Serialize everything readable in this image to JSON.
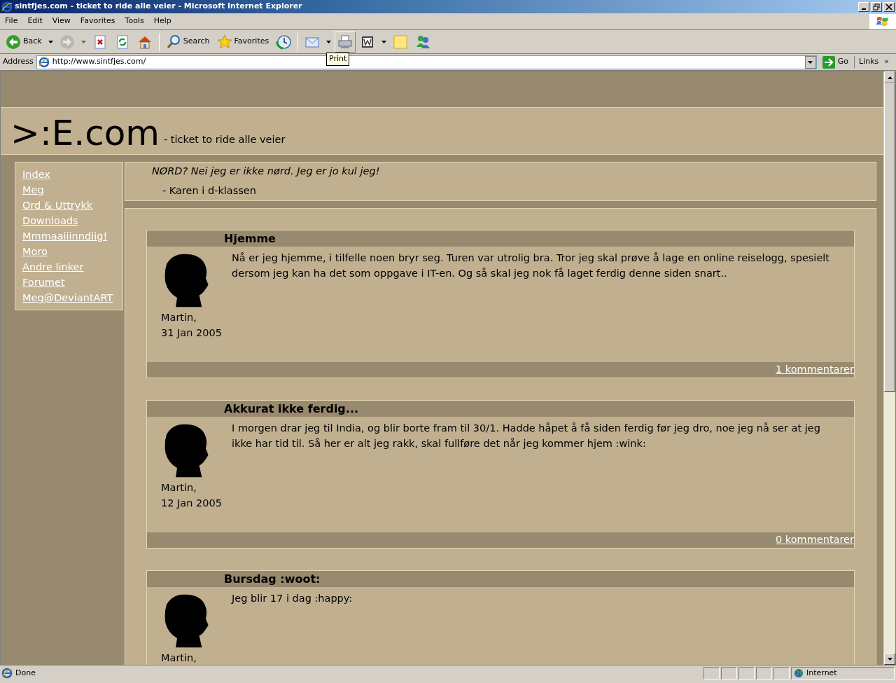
{
  "window": {
    "title": "sintfjes.com - ticket to ride alle veier - Microsoft Internet Explorer"
  },
  "menu": [
    "File",
    "Edit",
    "View",
    "Favorites",
    "Tools",
    "Help"
  ],
  "toolbar": [
    {
      "kind": "button",
      "label": "Back",
      "dropdown": true,
      "disabled": false,
      "hover": false
    },
    {
      "kind": "button",
      "dropdown": true,
      "disabled": true,
      "hover": false
    },
    {
      "kind": "button",
      "disabled": false,
      "hover": false
    },
    {
      "kind": "button",
      "disabled": false,
      "hover": false
    },
    {
      "kind": "button",
      "disabled": false,
      "hover": false
    },
    {
      "kind": "separator"
    },
    {
      "kind": "button",
      "label": "Search",
      "disabled": false,
      "hover": false
    },
    {
      "kind": "button",
      "label": "Favorites",
      "disabled": false,
      "hover": false
    },
    {
      "kind": "button",
      "disabled": false,
      "hover": false
    },
    {
      "kind": "separator"
    },
    {
      "kind": "button",
      "dropdown": true,
      "disabled": false,
      "hover": false
    },
    {
      "kind": "button",
      "disabled": false,
      "hover": true,
      "tooltip": "Print"
    },
    {
      "kind": "button",
      "dropdown": true,
      "disabled": false,
      "hover": false
    },
    {
      "kind": "button",
      "disabled": false,
      "hover": false
    },
    {
      "kind": "button",
      "disabled": false,
      "hover": false
    }
  ],
  "address": {
    "label": "Address",
    "url": "http://www.sintfjes.com/",
    "go": "Go",
    "links": "Links",
    "more": "»"
  },
  "page": {
    "site_title": ">:E.com",
    "tagline": "- ticket to ride alle veier",
    "nav": [
      "Index",
      "Meg",
      "Ord & Uttrykk",
      "Downloads",
      "Mmmaaiiinndiig!",
      "Moro",
      "Andre linker",
      "Forumet",
      "Meg@DeviantART"
    ],
    "quote": {
      "text": "NØRD? Nei jeg er ikke nørd. Jeg er jo kul jeg!",
      "attribution": "- Karen i d-klassen"
    },
    "posts": [
      {
        "title": "Hjemme",
        "body": "Nå er jeg hjemme, i tilfelle noen bryr seg. Turen var utrolig bra. Tror jeg skal prøve å lage en online reiselogg, spesielt dersom jeg kan ha det som oppgave i IT-en. Og så skal jeg nok få laget ferdig denne siden snart..",
        "author": "Martin,",
        "date": "31 Jan 2005",
        "comments": "1 kommentarer"
      },
      {
        "title": "Akkurat ikke ferdig...",
        "body": "I morgen drar jeg til India, og blir borte fram til 30/1. Hadde håpet å få siden ferdig før jeg dro, noe jeg nå ser at jeg ikke har tid til. Så her er alt jeg rakk, skal fullføre det når jeg kommer hjem :wink:",
        "author": "Martin,",
        "date": "12 Jan 2005",
        "comments": "0 kommentarer"
      },
      {
        "title": "Bursdag :woot:",
        "body": "Jeg blir 17 i dag :happy:",
        "author": "Martin,"
      }
    ]
  },
  "status": {
    "text": "Done",
    "zone": "Internet"
  }
}
